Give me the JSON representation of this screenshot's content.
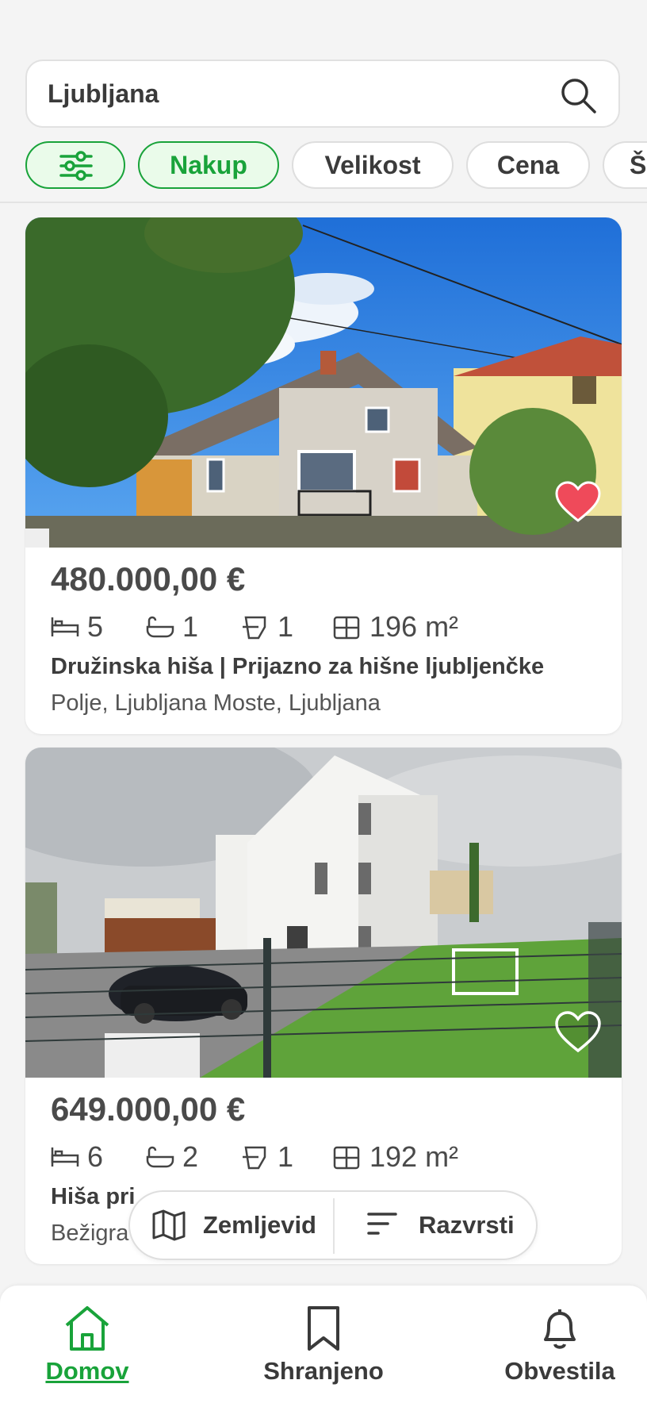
{
  "search": {
    "value": "Ljubljana"
  },
  "filters": {
    "chips": [
      {
        "label": "Nakup",
        "active": true
      },
      {
        "label": "Velikost",
        "active": false
      },
      {
        "label": "Cena",
        "active": false
      },
      {
        "label": "Š",
        "active": false
      }
    ]
  },
  "listings": [
    {
      "price": "480.000,00 €",
      "bedrooms": "5",
      "bathrooms": "1",
      "toilets": "1",
      "area": "196 m²",
      "title": "Družinska hiša | Prijazno za hišne ljubljenčke",
      "address": "Polje, Ljubljana Moste, Ljubljana",
      "saved": true
    },
    {
      "price": "649.000,00 €",
      "bedrooms": "6",
      "bathrooms": "2",
      "toilets": "1",
      "area": "192 m²",
      "title": "Hiša pri",
      "address": "Bežigra",
      "saved": false
    }
  ],
  "floating_actions": {
    "map_label": "Zemljevid",
    "sort_label": "Razvrsti"
  },
  "bottom_nav": {
    "items": [
      {
        "label": "Domov",
        "active": true
      },
      {
        "label": "Shranjeno",
        "active": false
      },
      {
        "label": "Obvestila",
        "active": false
      }
    ]
  },
  "colors": {
    "accent": "#19a33a",
    "saved_heart": "#ef4a5a"
  }
}
